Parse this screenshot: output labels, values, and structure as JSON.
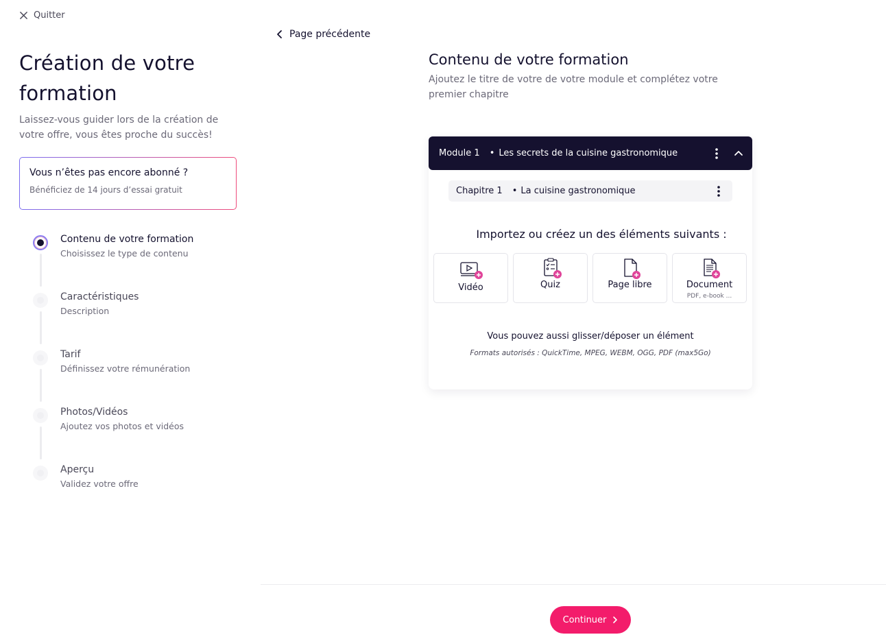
{
  "colors": {
    "accent": "#f31c6b",
    "dark": "#15112f",
    "muted": "#6b6978",
    "gradient_start": "#7a6cf0",
    "gradient_end": "#ee4b7b"
  },
  "header": {
    "quit_label": "Quitter",
    "quit_icon": "close-icon"
  },
  "sidebar": {
    "title": "Création de votre formation",
    "subtitle": "Laissez-vous guider lors de la création de votre offre, vous êtes proche du succès!",
    "promo": {
      "title": "Vous n’êtes pas encore abonné ?",
      "text": "Bénéficiez de 14 jours d’essai gratuit"
    },
    "steps": [
      {
        "label": "Contenu de votre formation",
        "desc": "Choisissez le type de contenu",
        "active": true
      },
      {
        "label": "Caractéristiques",
        "desc": "Description",
        "active": false
      },
      {
        "label": "Tarif",
        "desc": "Définissez votre rémunération",
        "active": false
      },
      {
        "label": "Photos/Vidéos",
        "desc": "Ajoutez vos photos et vidéos",
        "active": false
      },
      {
        "label": "Aperçu",
        "desc": "Validez votre offre",
        "active": false
      }
    ]
  },
  "main": {
    "back_label": "Page précédente",
    "title": "Contenu de votre formation",
    "subtitle": "Ajoutez le titre de votre de votre module et complétez votre premier chapitre",
    "module": {
      "number": "Module 1",
      "separator": "•",
      "name": "Les secrets de la cuisine gastronomique"
    },
    "chapter": {
      "number": "Chapitre 1",
      "separator": "•",
      "name": "La cuisine gastronomique"
    },
    "import_title": "Importez ou créez un des éléments suivants :",
    "tiles": [
      {
        "label": "Vidéo",
        "icon": "video-add-icon",
        "hint": ""
      },
      {
        "label": "Quiz",
        "icon": "quiz-add-icon",
        "hint": ""
      },
      {
        "label": "Page libre",
        "icon": "page-add-icon",
        "hint": ""
      },
      {
        "label": "Document",
        "icon": "document-add-icon",
        "hint": "PDF, e-book ..."
      }
    ],
    "dnd_text": "Vous pouvez aussi glisser/déposer un élément",
    "formats_text": "Formats autorisés : QuickTime, MPEG, WEBM, OGG, PDF (max5Go)"
  },
  "footer": {
    "continue_label": "Continuer"
  }
}
